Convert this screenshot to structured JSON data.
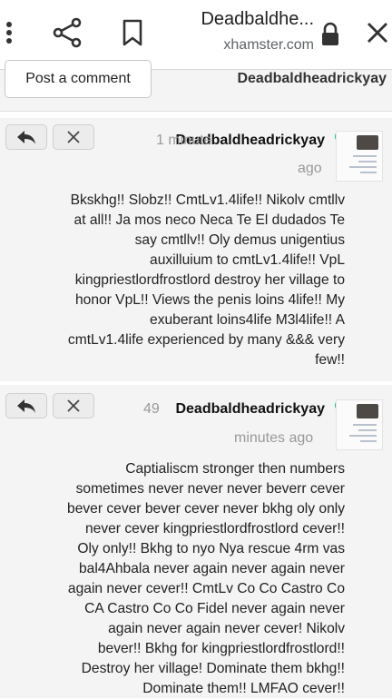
{
  "browser": {
    "title": "Deadbaldhe...",
    "domain": "xhamster.com",
    "icons": [
      "more-vert-icon",
      "share-icon",
      "bookmark-icon",
      "lock-icon",
      "close-icon"
    ]
  },
  "header": {
    "post_comment_label": "Post a comment",
    "username": "Deadbaldheadrickyay"
  },
  "comments": [
    {
      "author": "Deadbaldheadrickyay",
      "time_line1": "1 minute",
      "time_line2": "ago",
      "online": true,
      "lines": [
        "Bkskhg!! Slobz!! CmtLv1.4life!! Nikolv cmtllv",
        "at all!! Ja mos neco Neca Te El dudados Te",
        "say cmtllv!! Oly demus unigentius",
        "auxilluium to cmtLv1.4life!! VpL",
        "kingpriestlordfrostlord destroy her village to",
        "honor VpL!! Views the penis loins 4life!! My",
        "exuberant loins4life M3l4life!! A",
        "cmtLv1.4life experienced by many &&& very",
        "few!!"
      ]
    },
    {
      "author": "Deadbaldheadrickyay",
      "time_line1": "49",
      "time_line2": "minutes ago",
      "online": true,
      "lines": [
        "Captialiscm stronger then numbers",
        "sometimes never never never beverr cever",
        "bever cever bever cever never bkhg oly only",
        "never cever kingpriestlordfrostlord cever!!",
        "Oly only!! Bkhg to nyo Nya rescue 4rm vas",
        "bal4Ahbala never again never again never",
        "again never cever!! CmtLv Co Co Castro Co",
        "CA Castro Co Co Fidel never again never",
        "again never again never cever! Nikolv",
        "bever!! Bkhg for kingpriestlordfrostlord!!",
        "Destroy her village! Dominate them bkhg!!",
        "Dominate them!! LMFAO cever!!"
      ]
    }
  ]
}
